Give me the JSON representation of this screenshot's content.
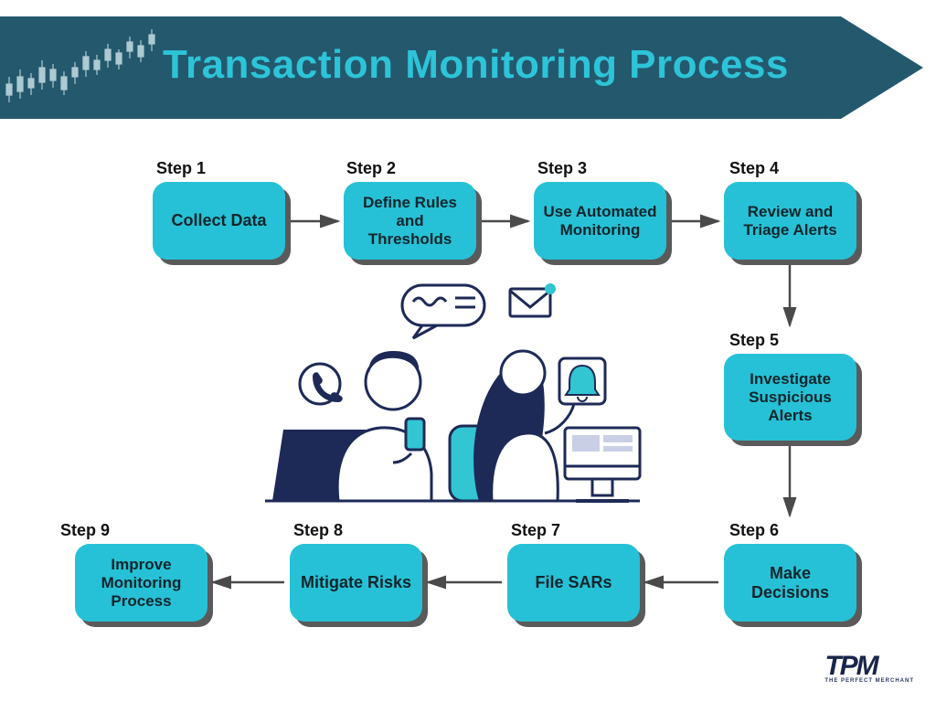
{
  "header": {
    "title": "Transaction Monitoring Process",
    "accent_color": "#2dc4d8",
    "banner_color": "#24586d"
  },
  "steps": [
    {
      "n": "Step 1",
      "label": "Collect Data"
    },
    {
      "n": "Step 2",
      "label": "Define Rules and Thresholds"
    },
    {
      "n": "Step 3",
      "label": "Use Automated Monitoring"
    },
    {
      "n": "Step 4",
      "label": "Review and Triage Alerts"
    },
    {
      "n": "Step 5",
      "label": "Investigate Suspicious Alerts"
    },
    {
      "n": "Step 6",
      "label": "Make Decisions"
    },
    {
      "n": "Step 7",
      "label": "File SARs"
    },
    {
      "n": "Step 8",
      "label": "Mitigate Risks"
    },
    {
      "n": "Step 9",
      "label": "Improve Monitoring Process"
    }
  ],
  "logo": {
    "text": "TPM",
    "subtext": "THE PERFECT MERCHANT"
  },
  "colors": {
    "box_fill": "#26c1d6",
    "box_shadow": "#5a5a5a",
    "arrow": "#4a4a4a",
    "banner_fill": "#24586d",
    "title_fill": "#2dc4d8"
  },
  "illustration": {
    "description": "two-people-communication-icons",
    "icons": [
      "phone-icon",
      "chat-bubble-icon",
      "envelope-icon",
      "bell-icon",
      "laptop-icon",
      "desktop-icon"
    ]
  }
}
